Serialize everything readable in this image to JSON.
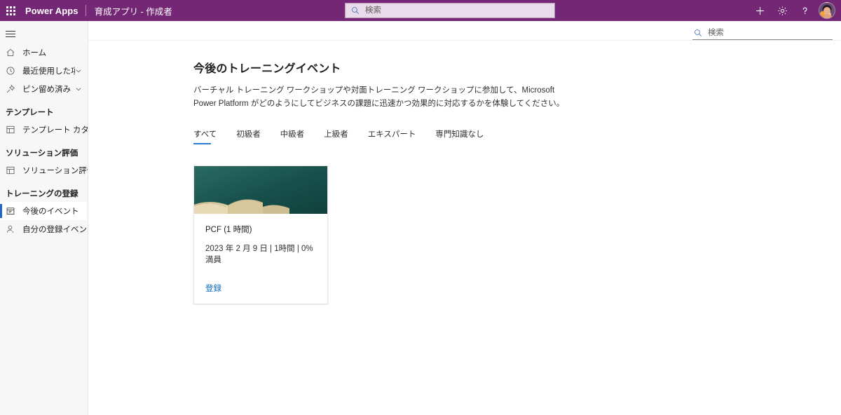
{
  "topbar": {
    "waffle_label": "waffle-menu",
    "brand": "Power Apps",
    "app_name": "育成アプリ - 作成者",
    "search": {
      "placeholder": "検索",
      "value": ""
    },
    "actions": [
      {
        "name": "add-button",
        "glyph": "+"
      },
      {
        "name": "settings-button",
        "glyph": "gear"
      },
      {
        "name": "help-button",
        "glyph": "?"
      }
    ],
    "avatar_label": "user-avatar"
  },
  "sidebar": {
    "items": [
      {
        "label": "ホーム",
        "icon": "home-icon",
        "chevron": false,
        "selected": false
      },
      {
        "label": "最近使用した項目",
        "icon": "clock-icon",
        "chevron": true,
        "selected": false
      },
      {
        "label": "ピン留め済み",
        "icon": "pin-icon",
        "chevron": true,
        "selected": false
      }
    ],
    "groups": [
      {
        "title": "テンプレート",
        "items": [
          {
            "label": "テンプレート カタログ",
            "icon": "catalog-icon",
            "selected": false
          }
        ]
      },
      {
        "title": "ソリューション評価",
        "items": [
          {
            "label": "ソリューション評価",
            "icon": "catalog-icon",
            "selected": false
          }
        ]
      },
      {
        "title": "トレーニングの登録",
        "items": [
          {
            "label": "今後のイベント",
            "icon": "calendar-icon",
            "selected": true
          },
          {
            "label": "自分の登録イベント",
            "icon": "person-icon",
            "selected": false
          }
        ]
      }
    ]
  },
  "main": {
    "search": {
      "placeholder": "検索",
      "value": ""
    },
    "title": "今後のトレーニングイベント",
    "description": "バーチャル トレーニング ワークショップや対面トレーニング ワークショップに参加して、Microsoft Power Platform がどのようにしてビジネスの課題に迅速かつ効果的に対応するかを体験してください。",
    "tabs": [
      {
        "label": "すべて",
        "active": true
      },
      {
        "label": "初級者",
        "active": false
      },
      {
        "label": "中級者",
        "active": false
      },
      {
        "label": "上級者",
        "active": false
      },
      {
        "label": "エキスパート",
        "active": false
      },
      {
        "label": "専門知識なし",
        "active": false
      }
    ],
    "cards": [
      {
        "image_alt": "open-books-photo",
        "title": "PCF (1 時間)",
        "meta": "2023 年 2 月 9 日 | 1時間 | 0% 満員",
        "link": "登録"
      }
    ]
  },
  "colors": {
    "brand_purple": "#742774",
    "accent_blue": "#2b7cd3",
    "link_blue": "#0f6cbd",
    "sidebar_bg": "#f7f7f7",
    "card_image_teal": "#17504b"
  }
}
